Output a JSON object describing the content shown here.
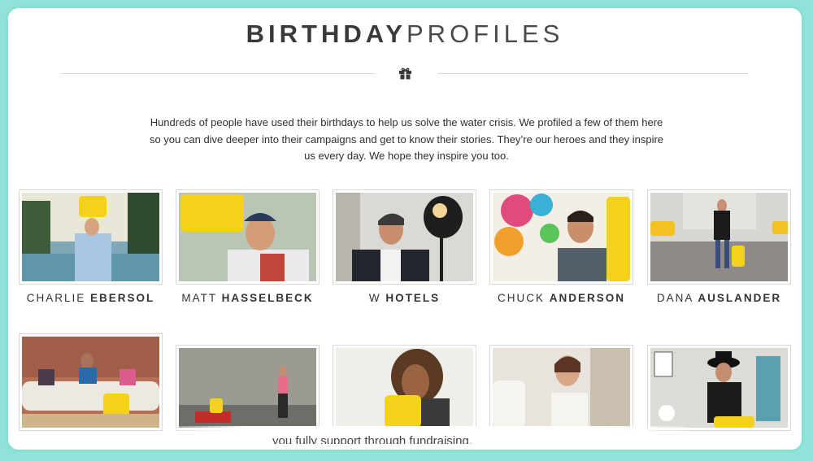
{
  "header": {
    "title_bold": "BIRTHDAY",
    "title_light": "PROFILES"
  },
  "intro": {
    "text": "Hundreds of people have used their birthdays to help us solve the water crisis. We profiled a few of them here so you can dive deeper into their campaigns and get to know their stories. They’re our heroes and they inspire us every day. We hope they inspire you too."
  },
  "icons": {
    "divider_icon": "gift-icon"
  },
  "colors": {
    "frame_border": "#86e0d4",
    "jerrycan_yellow": "#f4d21a",
    "text": "#333333"
  },
  "profiles_row1": [
    {
      "first": "CHARLIE",
      "last": "EBERSOL"
    },
    {
      "first": "MATT",
      "last": "HASSELBECK"
    },
    {
      "first": "W",
      "last": "HOTELS"
    },
    {
      "first": "CHUCK",
      "last": "ANDERSON"
    },
    {
      "first": "DANA",
      "last": "AUSLANDER"
    }
  ],
  "footer_overlay": {
    "text": "you fully support through fundraising."
  }
}
